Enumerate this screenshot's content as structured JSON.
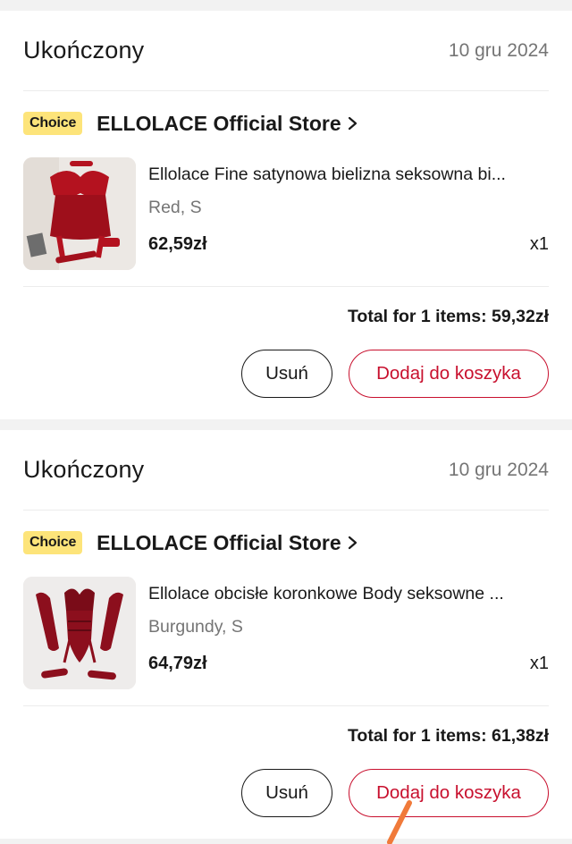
{
  "orders": [
    {
      "status": "Ukończony",
      "date": "10 gru 2024",
      "badge": "Choice",
      "store": "ELLOLACE Official Store",
      "item": {
        "title": "Ellolace Fine satynowa bielizna seksowna bi...",
        "variant": "Red, S",
        "price": "62,59zł",
        "qty": "x1"
      },
      "total": "Total for 1 items: 59,32zł",
      "remove_label": "Usuń",
      "add_to_cart_label": "Dodaj do koszyka"
    },
    {
      "status": "Ukończony",
      "date": "10 gru 2024",
      "badge": "Choice",
      "store": "ELLOLACE Official Store",
      "item": {
        "title": "Ellolace obcisłe koronkowe Body seksowne ...",
        "variant": "Burgundy, S",
        "price": "64,79zł",
        "qty": "x1"
      },
      "total": "Total for 1 items: 61,38zł",
      "remove_label": "Usuń",
      "add_to_cart_label": "Dodaj do koszyka"
    }
  ],
  "colors": {
    "accent": "#c8102e",
    "badge": "#fde47a",
    "pointer": "#f07a3a"
  }
}
